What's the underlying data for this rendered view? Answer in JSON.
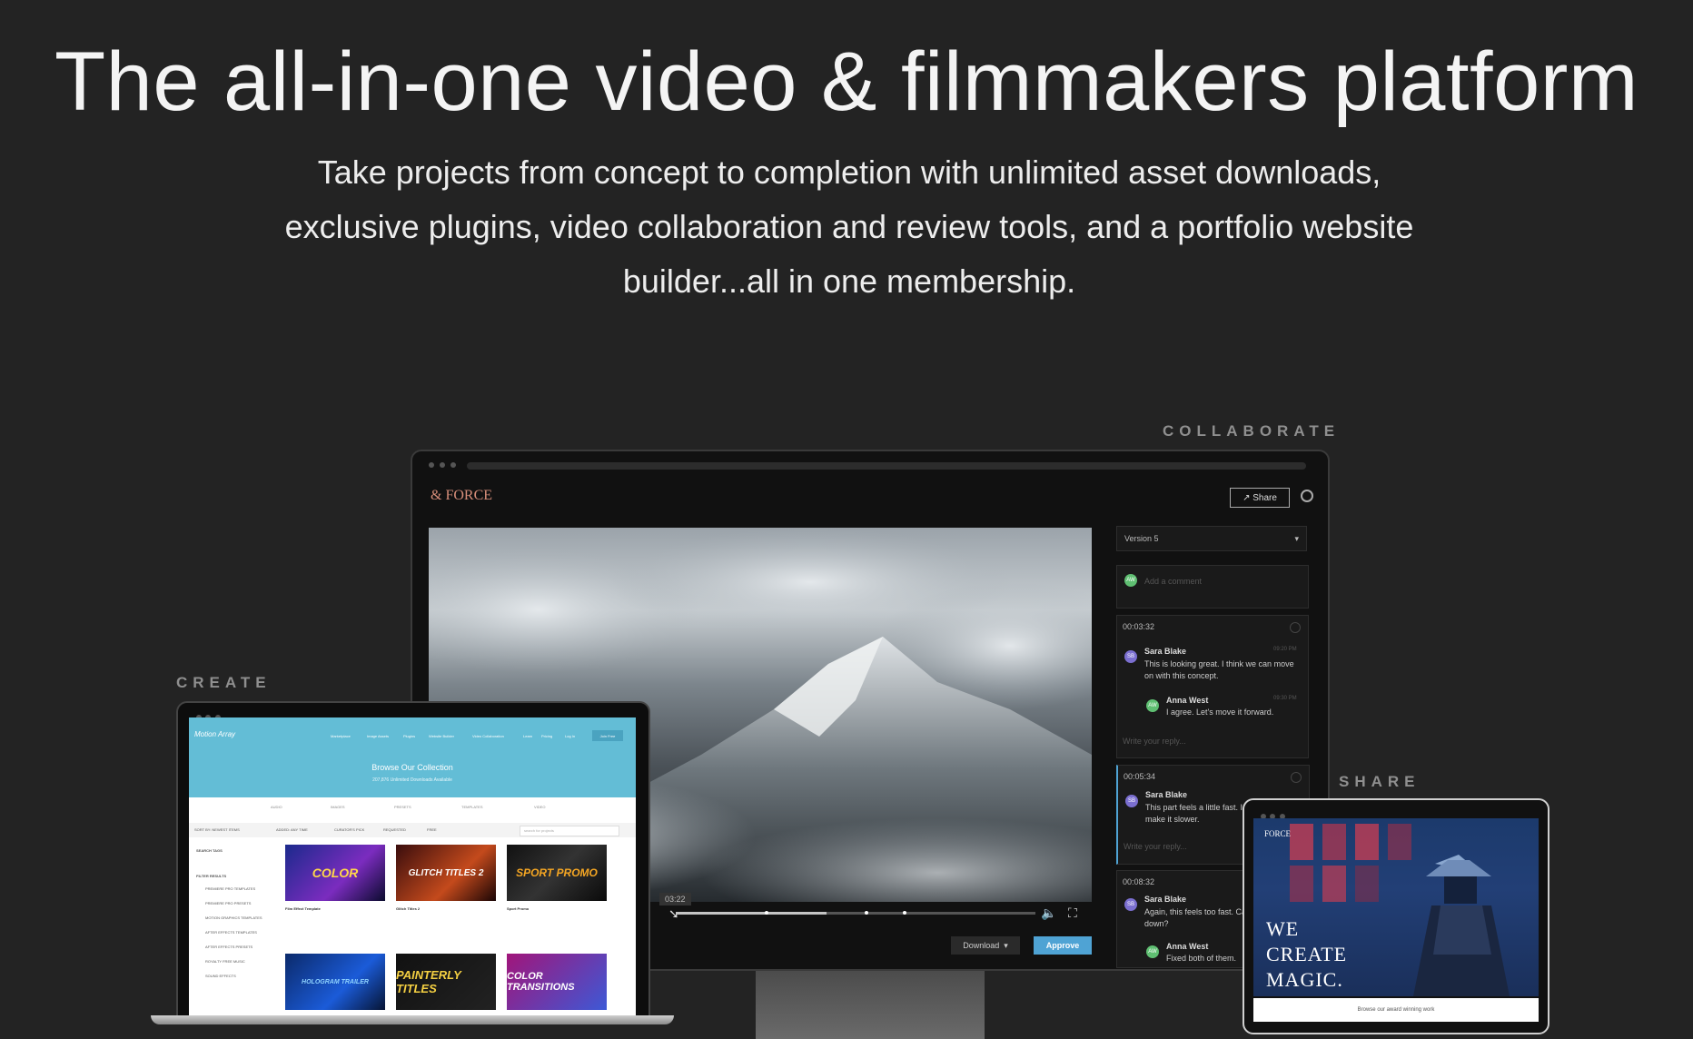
{
  "hero": {
    "title": "The all-in-one video & filmmakers platform",
    "subtitle": "Take projects from concept to completion with unlimited asset downloads, exclusive plugins, video collaboration and review tools, and a portfolio website builder...all in one membership."
  },
  "labels": {
    "collaborate": "COLLABORATE",
    "create": "CREATE",
    "share": "SHARE"
  },
  "review_app": {
    "brand": "FORCE",
    "brand_prefix": "&",
    "share_label": "Share",
    "version_select": "Version 5",
    "comment_placeholder": "Add a comment",
    "reply_placeholder": "Write your reply...",
    "timecode_chip": "03:22",
    "download_label": "Download",
    "approve_label": "Approve",
    "comment_threads": [
      {
        "time": "00:03:32",
        "messages": [
          {
            "initials": "SB",
            "author": "Sara Blake",
            "ts": "09:20 PM",
            "text": "This is looking great. I think we can move on with this concept."
          },
          {
            "initials": "AW",
            "author": "Anna West",
            "ts": "09:30 PM",
            "text": "I agree. Let's move it forward."
          }
        ]
      },
      {
        "time": "00:05:34",
        "messages": [
          {
            "initials": "SB",
            "author": "Sara Blake",
            "ts": "",
            "text": "This part feels a little fast. I think we can make it slower."
          }
        ]
      },
      {
        "time": "00:08:32",
        "messages": [
          {
            "initials": "SB",
            "author": "Sara Blake",
            "ts": "",
            "text": "Again, this feels too fast. Can we slow it down?"
          },
          {
            "initials": "AW",
            "author": "Anna West",
            "ts": "",
            "text": "Fixed both of them."
          }
        ]
      }
    ],
    "colors": {
      "approve": "#4fa3d4",
      "avatar_sb": "#7b6fd0",
      "avatar_aw": "#5fbf72"
    }
  },
  "marketplace_app": {
    "brand": "Motion Array",
    "nav": [
      "Marketplace",
      "Image Assets",
      "Plugins",
      "Website Builder",
      "Video Collaboration",
      "Learn",
      "Pricing",
      "Log In"
    ],
    "join_label": "Join Free",
    "heading": "Browse Our Collection",
    "subheading": "207,876 Unlimited Downloads Available",
    "categories": [
      "AUDIO",
      "IMAGES",
      "PRESETS",
      "TEMPLATES",
      "VIDEO"
    ],
    "toolbar": [
      "SORT BY: NEWEST ITEMS",
      "ADDED: ANY TIME",
      "CURATOR'S PICK",
      "REQUESTED",
      "FREE"
    ],
    "search_placeholder": "search for projects",
    "sidebar": {
      "search_tags": "SEARCH TAGS",
      "filter_results": "FILTER RESULTS",
      "filters": [
        "PREMIERE PRO TEMPLATES",
        "PREMIERE PRO PRESETS",
        "MOTION GRAPHICS TEMPLATES",
        "AFTER EFFECTS TEMPLATES",
        "AFTER EFFECTS PRESETS",
        "ROYALTY FREE MUSIC",
        "SOUND EFFECTS"
      ]
    },
    "items": [
      {
        "caption": "Film Effect Template",
        "art": "COLOR"
      },
      {
        "caption": "Glitch Titles 2",
        "art": "GLITCH TITLES 2"
      },
      {
        "caption": "Sport Promo",
        "art": "SPORT PROMO"
      },
      {
        "caption": "",
        "art": "HOLOGRAM TRAILER"
      },
      {
        "caption": "",
        "art": "PAINTERLY TITLES"
      },
      {
        "caption": "",
        "art": "COLOR TRANSITIONS"
      }
    ],
    "colors": {
      "header": "#63bdd6"
    }
  },
  "portfolio_app": {
    "brand": "FORCE",
    "headline": "WE\nCREATE\nMAGIC.",
    "footer": "Browse our award winning work"
  }
}
